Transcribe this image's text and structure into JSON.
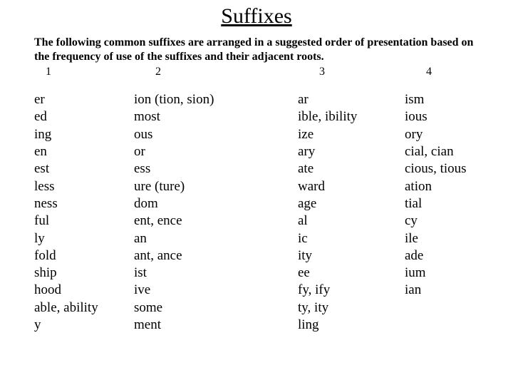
{
  "title": "Suffixes",
  "intro": "The following common suffixes are arranged in a suggested order of presentation based on the frequency of use of the suffixes and their adjacent roots.",
  "headers": {
    "h1": "1",
    "h2": "2",
    "h3": "3",
    "h4": "4"
  },
  "columns": {
    "c1": [
      "er",
      "ed",
      "ing",
      "en",
      "est",
      "less",
      "ness",
      "ful",
      "ly",
      "fold",
      "ship",
      "hood",
      "able, ability",
      "y"
    ],
    "c2": [
      "ion (tion, sion)",
      "most",
      "ous",
      "or",
      "ess",
      "ure (ture)",
      "dom",
      "ent, ence",
      "an",
      "ant, ance",
      "ist",
      "ive",
      "some",
      "ment"
    ],
    "c3": [
      "ar",
      "ible, ibility",
      "ize",
      "ary",
      "ate",
      "ward",
      "age",
      "al",
      "ic",
      "ity",
      "ee",
      "fy, ify",
      "ty, ity",
      "ling"
    ],
    "c4": [
      "ism",
      "ious",
      "ory",
      "cial, cian",
      "cious, tious",
      "ation",
      "tial",
      "cy",
      "ile",
      "ade",
      "ium",
      "ian"
    ]
  }
}
